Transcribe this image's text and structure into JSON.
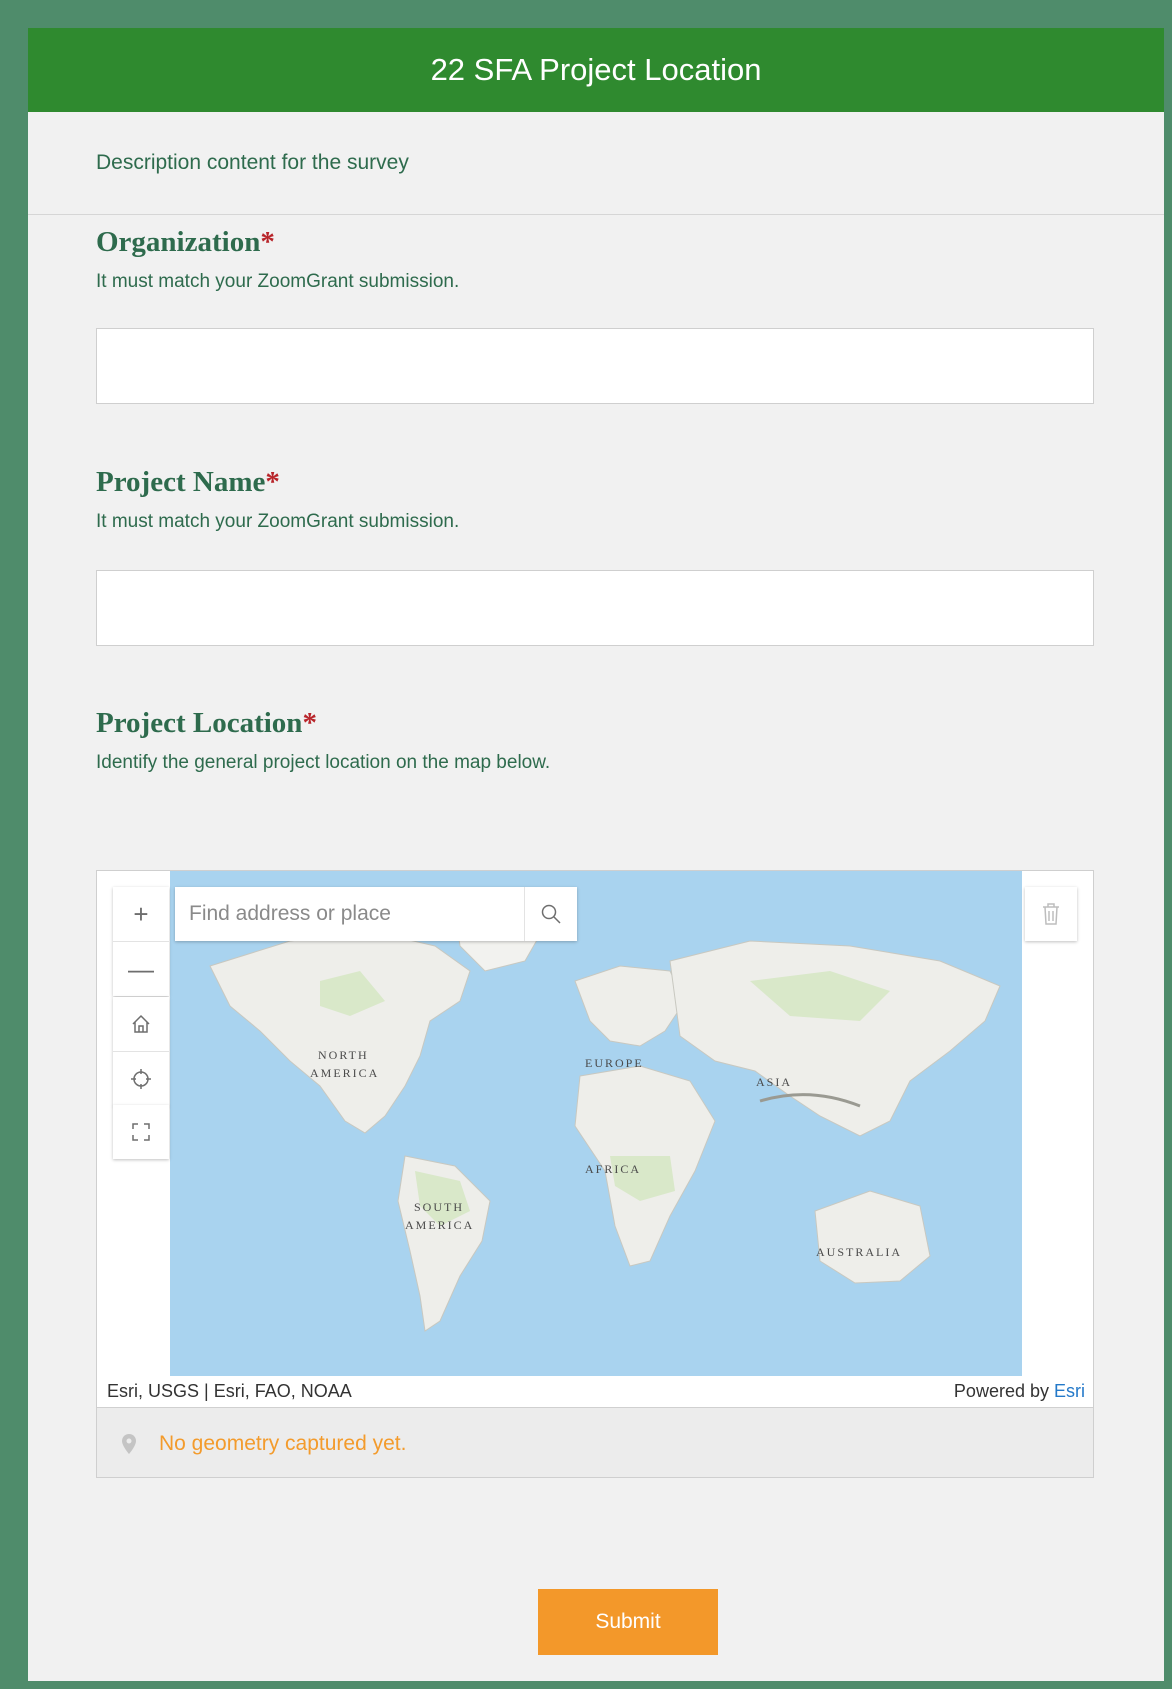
{
  "header": {
    "title": "22 SFA Project Location"
  },
  "description": "Description content for the survey",
  "questions": [
    {
      "label": "Organization",
      "required_mark": "*",
      "hint": "It must match your ZoomGrant submission.",
      "value": ""
    },
    {
      "label": "Project Name",
      "required_mark": "*",
      "hint": "It must match your ZoomGrant submission.",
      "value": ""
    },
    {
      "label": "Project Location",
      "required_mark": "*",
      "hint": "Identify the general project location on the map below."
    }
  ],
  "map": {
    "search_placeholder": "Find address or place",
    "continents": [
      "NORTH",
      "AMERICA",
      "EUROPE",
      "ASIA",
      "AFRICA",
      "SOUTH",
      "AMERICA",
      "AUSTRALIA"
    ],
    "attribution": "Esri, USGS | Esri, FAO, NOAA",
    "powered_by": "Powered by",
    "powered_link": "Esri",
    "status": "No geometry captured yet."
  },
  "submit_label": "Submit",
  "colors": {
    "header": "#2f8a2f",
    "accent": "#f3982a",
    "label": "#2e6b4d",
    "required": "#b8242a",
    "water": "#a9d3ef",
    "land": "#eeeeea"
  },
  "icons": [
    "plus-icon",
    "minus-icon",
    "home-icon",
    "locate-icon",
    "fullscreen-icon",
    "search-icon",
    "trash-icon",
    "pin-icon"
  ]
}
